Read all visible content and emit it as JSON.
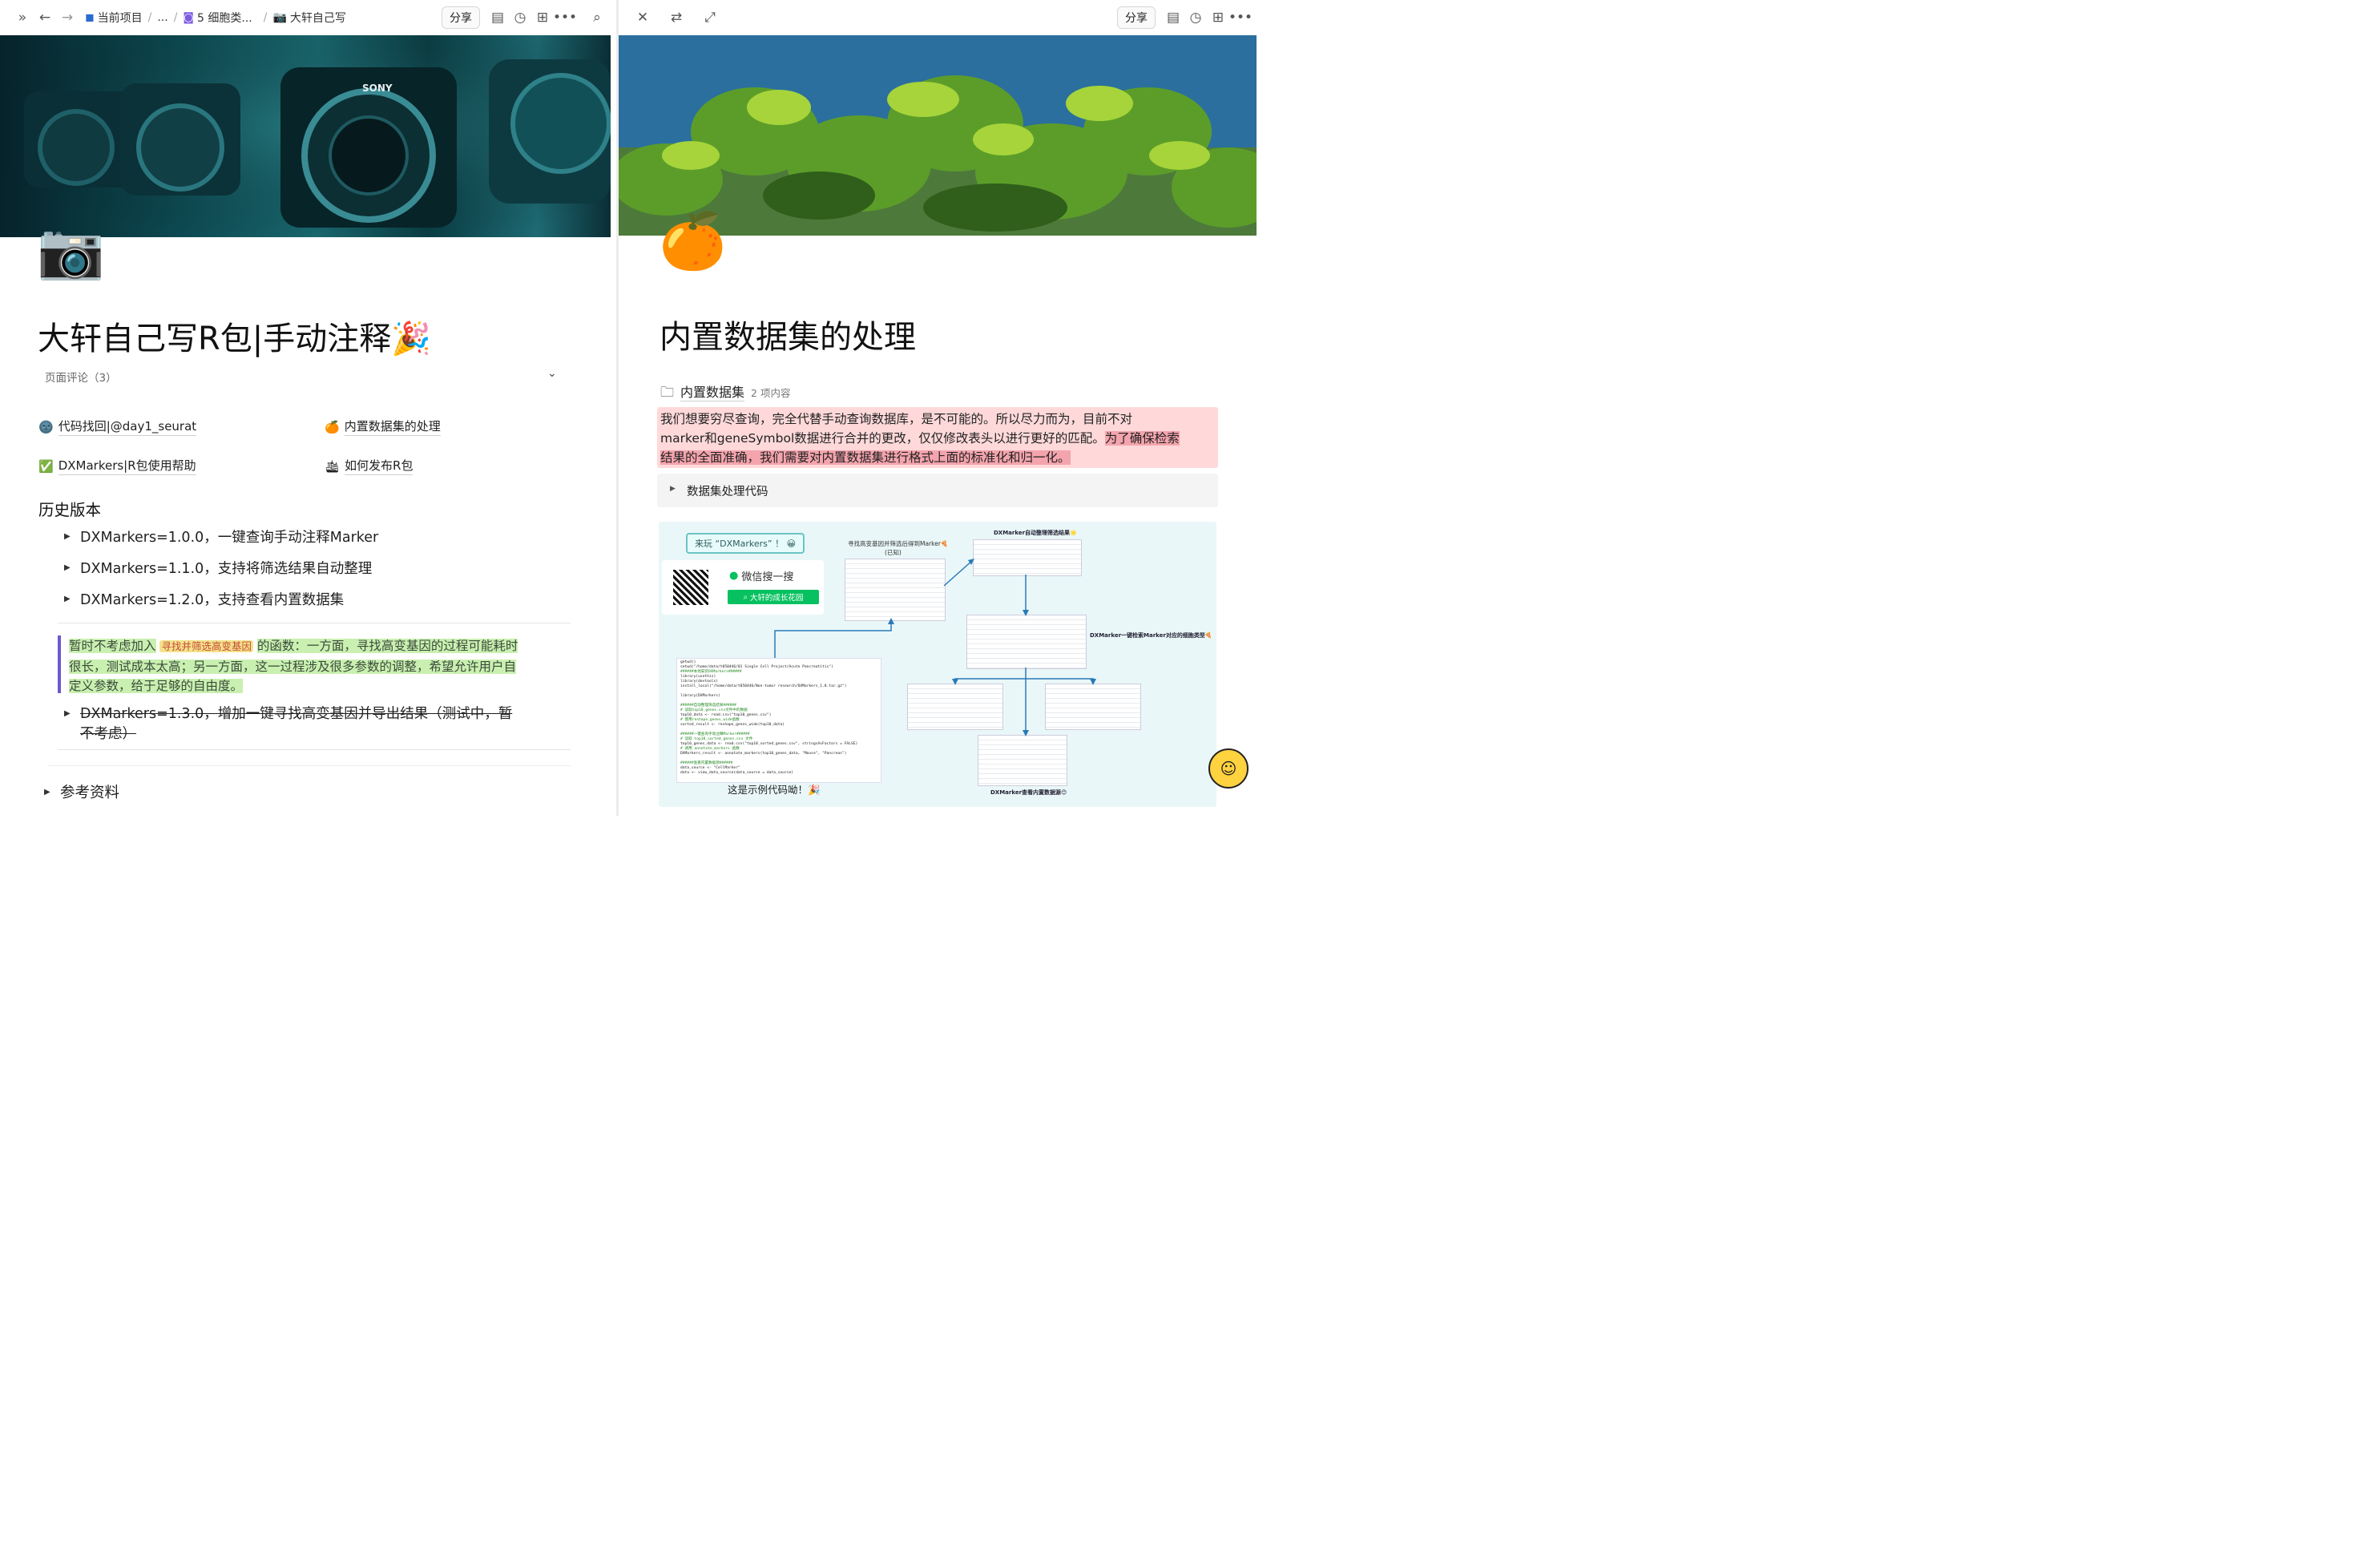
{
  "left": {
    "breadcrumbs": {
      "project": "当前项目",
      "ellipsis": "...",
      "folder": "5 细胞类...",
      "page": "大轩自己写"
    },
    "toolbar": {
      "share": "分享"
    },
    "page": {
      "title": "大轩自己写R包|手动注释🎉",
      "comments": "页面评论（3）",
      "links": [
        {
          "icon": "🌚",
          "label": "代码找回|@day1_seurat"
        },
        {
          "icon": "🍊",
          "label": "内置数据集的处理"
        },
        {
          "icon": "✅",
          "label": "DXMarkers|R包使用帮助"
        },
        {
          "icon": "🛳",
          "label": "如何发布R包"
        }
      ],
      "history_heading": "历史版本",
      "versions": [
        "DXMarkers=1.0.0，一键查询手动注释Marker",
        "DXMarkers=1.1.0，支持将筛选结果自动整理",
        "DXMarkers=1.2.0，支持查看内置数据集"
      ],
      "callout": {
        "seg1": "暂时不考虑加入",
        "seg2": "寻找并筛选高变基因",
        "seg3": "的函数：一方面，寻找高变基因的过程可能耗时",
        "line2": "很长，测试成本太高；另一方面，这一过程涉及很多参数的调整，希望允许用户自",
        "line3": "定义参数，给于足够的自由度。"
      },
      "struck_version_line1": "DXMarkers=1.3.0，增加一键寻找高变基因并导出结果（测试中，暂",
      "struck_version_line2": "不考虑）",
      "references": "参考资料"
    }
  },
  "right": {
    "toolbar": {
      "share": "分享"
    },
    "page": {
      "title": "内置数据集的处理",
      "folder_name": "内置数据集",
      "folder_count": "2 项内容",
      "para": {
        "line1": "我们想要穷尽查询，完全代替手动查询数据库，是不可能的。所以尽力而为，目前不对",
        "line2a": "marker和geneSymbol数据进行合并的更改，仅仅修改表头以进行更好的匹配。",
        "line2b": "为了确保检索",
        "line3": "结果的全面准确，我们需要对内置数据集进行格式上面的标准化和归一化。"
      },
      "code_toggle": "数据集处理代码",
      "diagram": {
        "badge": "来玩 “DXMarkers” ！ 😀",
        "wechat_search": "微信搜一搜",
        "wechat_account": "大轩的成长花园",
        "caption_top": "寻找高变基因并筛选后得到Marker🍕",
        "caption_top_sub": "(已知)",
        "caption_auto": "DXMarker自动整理筛选结果🌟",
        "caption_cell": "DXMarker一键检索Marker对应的细胞类型🍕",
        "caption_builtin": "DXMarker查看内置数据源😊",
        "footer": "这是示例代码呦！🎉",
        "code_lines": [
          "getwd()",
          "setwd(\"/home/data/t050446/01 Single Cell Project/Acute Pancreatitis\")",
          "######本地安装DXMarkers######",
          "library(usethis)",
          "library(devtools)",
          "install_local(\"/home/data/t050446/Non-tumor research/DXMarkers_1.0.tar.gz\")",
          "",
          "library(DXMarkers)",
          "",
          "######自动整理筛选结果######",
          "# 读取top10_genes.csv文件中的数据",
          "top10_data <- read.csv(\"top10_genes.csv\")",
          "# 使用reshape_genes_wide函数",
          "sorted_result <- reshape_genes_wide(top10_data)",
          "",
          "######一键查询手动注释Marker######",
          "# 读取 top10_sorted_genes.csv 文件",
          "top10_genes_data <- read.csv(\"top10_sorted_genes.csv\", stringsAsFactors = FALSE)",
          "# 调用 annotate_markers 函数",
          "DXMarkers_result <- annotate_markers(top10_genes_data, \"Mouse\", \"Pancreas\")",
          "",
          "######查看内置数据源######",
          "data_source <- \"CellMarker\"",
          "data <- view_data_source(data_source = data_source)"
        ]
      }
    }
  },
  "colors": {
    "callout_bar": "#6a5acd",
    "highlight_yellow": "#f7f0a8",
    "highlight_green": "#c9f0b0",
    "highlight_red": "#f4a4ad",
    "para_bg": "#ffd9d9",
    "diagram_bg": "#eaf7f8",
    "wechat_green": "#07c160"
  },
  "icons": {
    "left_page_icon": "camera",
    "right_page_icon": "tangerine",
    "floating_helper": "smiley-face"
  }
}
